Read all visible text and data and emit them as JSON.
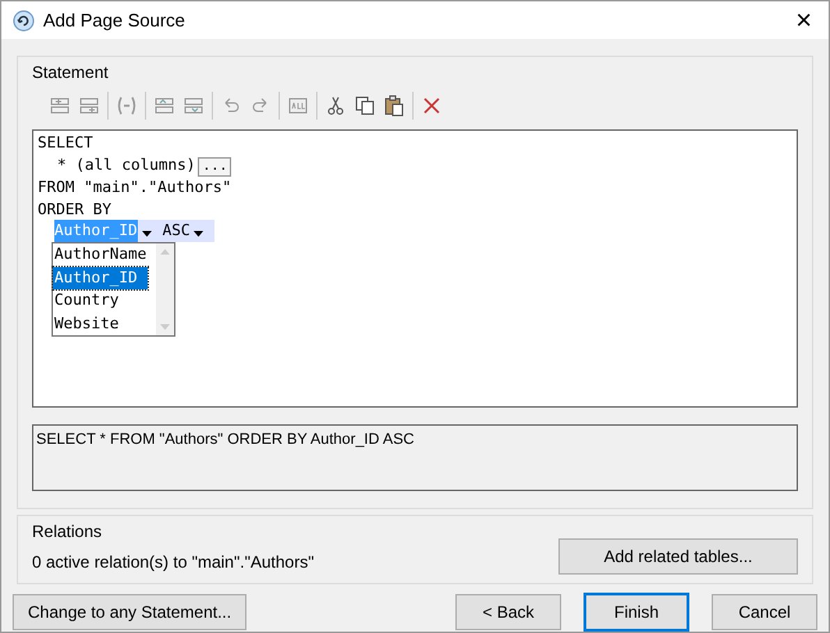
{
  "window": {
    "title": "Add Page Source",
    "close": "×"
  },
  "statement": {
    "label": "Statement",
    "editor": {
      "select": "SELECT",
      "columns": "* (all columns)",
      "columns_button": "...",
      "from": "FROM \"main\".\"Authors\"",
      "order_by": "ORDER BY",
      "order_column": "Author_ID",
      "order_direction": "ASC",
      "dropdown": [
        {
          "label": "AuthorName",
          "selected": false
        },
        {
          "label": "Author_ID",
          "selected": true
        },
        {
          "label": "Country",
          "selected": false
        },
        {
          "label": "Website",
          "selected": false
        }
      ]
    },
    "preview": "SELECT * FROM \"Authors\" ORDER BY Author_ID ASC"
  },
  "relations": {
    "label": "Relations",
    "text": "0 active relation(s) to \"main\".\"Authors\"",
    "button": "Add related tables..."
  },
  "footer": {
    "left_button": "Change to any Statement...",
    "buttons": [
      {
        "label": "< Back",
        "default": false
      },
      {
        "label": "Finish",
        "default": true
      },
      {
        "label": "Cancel",
        "default": false
      }
    ]
  }
}
